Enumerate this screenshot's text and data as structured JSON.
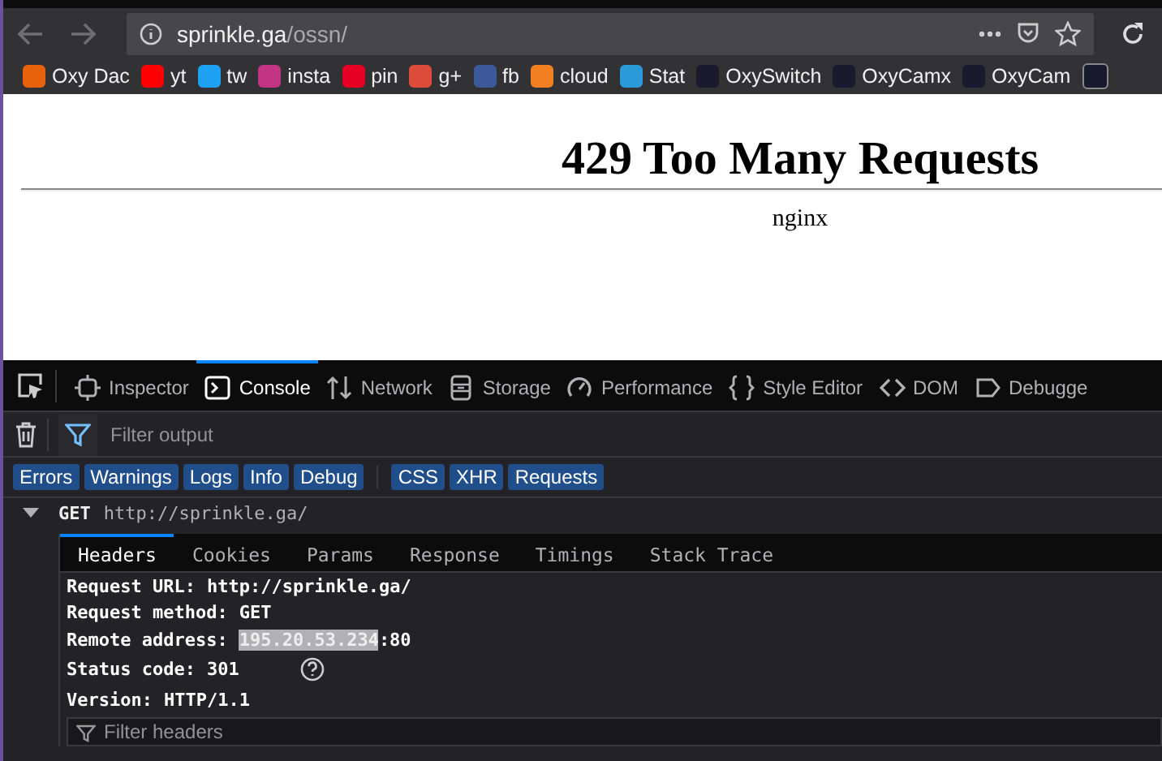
{
  "url": {
    "host": "sprinkle.ga",
    "path": "/ossn/"
  },
  "bookmarks": [
    {
      "label": "Oxy Dac",
      "color": "#e8620c"
    },
    {
      "label": "yt",
      "color": "#ff0000"
    },
    {
      "label": "tw",
      "color": "#1da1f2"
    },
    {
      "label": "insta",
      "color": "#c13584"
    },
    {
      "label": "pin",
      "color": "#e60023"
    },
    {
      "label": "g+",
      "color": "#dd4b39"
    },
    {
      "label": "fb",
      "color": "#3b5998"
    },
    {
      "label": "cloud",
      "color": "#f38020"
    },
    {
      "label": "Stat",
      "color": "#2a9bd8"
    },
    {
      "label": "OxySwitch",
      "color": "#1a1a2e"
    },
    {
      "label": "OxyCamx",
      "color": "#1a1a2e"
    },
    {
      "label": "OxyCam",
      "color": "#1a1a2e"
    }
  ],
  "page": {
    "heading": "429 Too Many Requests",
    "server": "nginx"
  },
  "devtools": {
    "tabs": [
      {
        "label": "Inspector",
        "kind": "inspector",
        "selected": false
      },
      {
        "label": "Console",
        "kind": "console",
        "selected": true
      },
      {
        "label": "Network",
        "kind": "network",
        "selected": false
      },
      {
        "label": "Storage",
        "kind": "storage",
        "selected": false
      },
      {
        "label": "Performance",
        "kind": "performance",
        "selected": false
      },
      {
        "label": "Style Editor",
        "kind": "style",
        "selected": false
      },
      {
        "label": "DOM",
        "kind": "dom",
        "selected": false
      },
      {
        "label": "Debugge",
        "kind": "debugger",
        "selected": false
      }
    ],
    "filter": {
      "placeholder": "Filter output"
    },
    "levels": [
      [
        {
          "label": "Errors",
          "selected": true
        },
        {
          "label": "Warnings",
          "selected": true
        },
        {
          "label": "Logs",
          "selected": true
        },
        {
          "label": "Info",
          "selected": true
        },
        {
          "label": "Debug",
          "selected": true
        }
      ],
      [
        {
          "label": "CSS",
          "selected": true
        },
        {
          "label": "XHR",
          "selected": true
        },
        {
          "label": "Requests",
          "selected": true
        }
      ]
    ],
    "request": {
      "method": "GET",
      "url": "http://sprinkle.ga/",
      "expanded": true,
      "tabs": [
        {
          "label": "Headers",
          "selected": true
        },
        {
          "label": "Cookies",
          "selected": false
        },
        {
          "label": "Params",
          "selected": false
        },
        {
          "label": "Response",
          "selected": false
        },
        {
          "label": "Timings",
          "selected": false
        },
        {
          "label": "Stack Trace",
          "selected": false
        }
      ],
      "rows": [
        {
          "label": "Request URL:",
          "value": "http://sprinkle.ga/"
        },
        {
          "label": "Request method:",
          "value": "GET"
        },
        {
          "label": "Remote address:",
          "selection": "195.20.53.234",
          "value": ":80"
        },
        {
          "label": "Status code:",
          "value": "301",
          "help": true
        },
        {
          "label": "Version:",
          "value": "HTTP/1.1"
        }
      ],
      "filter_placeholder": "Filter headers"
    }
  }
}
